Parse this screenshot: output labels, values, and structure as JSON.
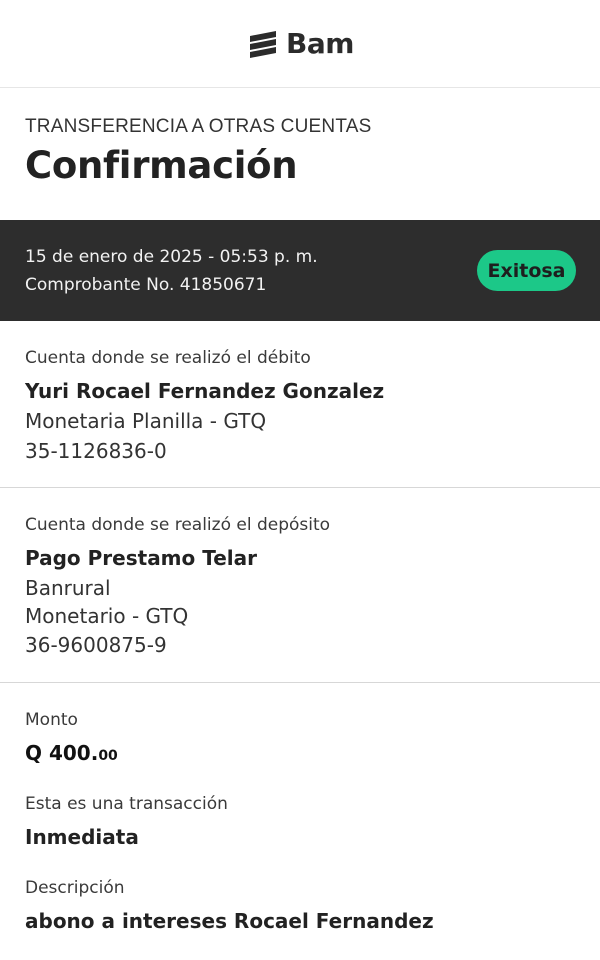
{
  "brand": {
    "name": "Bam"
  },
  "page": {
    "subtitle": "TRANSFERENCIA A OTRAS CUENTAS",
    "title": "Confirmación"
  },
  "status": {
    "datetime": "15 de enero de 2025 - 05:53 p. m.",
    "receipt": "Comprobante No. 41850671",
    "badge": "Exitosa"
  },
  "debit": {
    "label": "Cuenta donde se realizó el débito",
    "holder": "Yuri Rocael Fernandez Gonzalez",
    "account_type": "Monetaria Planilla - GTQ",
    "account_number": "35-1126836-0"
  },
  "deposit": {
    "label": "Cuenta donde se realizó el depósito",
    "holder": "Pago Prestamo Telar",
    "bank": "Banrural",
    "account_type": "Monetario - GTQ",
    "account_number": "36-9600875-9"
  },
  "details": {
    "amount_label": "Monto",
    "amount_main": "Q 400.",
    "amount_cents": "00",
    "transaction_label": "Esta es una transacción",
    "transaction_type": "Inmediata",
    "description_label": "Descripción",
    "description": "abono a intereses Rocael Fernandez"
  },
  "colors": {
    "status_bar": "#2d2d2d",
    "badge": "#1cc888"
  },
  "icons": {
    "logo": "bam-logo-icon"
  }
}
